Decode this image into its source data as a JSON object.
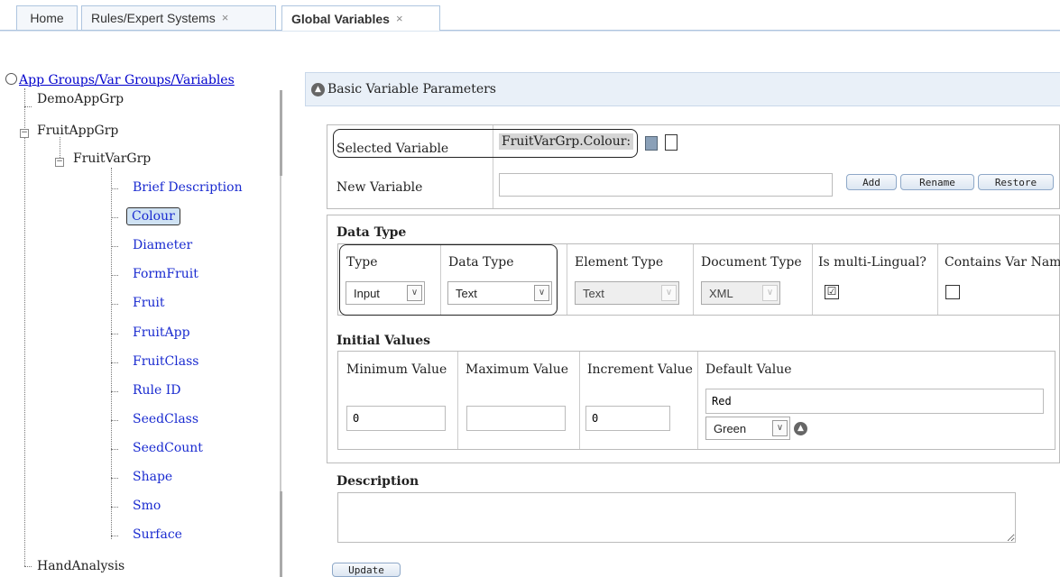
{
  "tabs": [
    {
      "label": "Home",
      "closable": false
    },
    {
      "label": "Rules/Expert Systems",
      "closable": true
    },
    {
      "label": "Global Variables",
      "closable": true,
      "active": true
    }
  ],
  "close_glyph": "×",
  "tree": {
    "root_label": "App Groups/Var Groups/Variables",
    "nodes": {
      "demo": "DemoAppGrp",
      "fruitapp": "FruitAppGrp",
      "fruitvar": "FruitVarGrp",
      "vars": [
        "Brief Description",
        "Colour",
        "Diameter",
        "FormFruit",
        "Fruit",
        "FruitApp",
        "FruitClass",
        "Rule ID",
        "SeedClass",
        "SeedCount",
        "Shape",
        "Smo",
        "Surface"
      ],
      "hand": "HandAnalysis"
    },
    "selected": "Colour"
  },
  "panel": {
    "title": "Basic Variable Parameters",
    "selected_variable_label": "Selected Variable",
    "selected_variable_value": "FruitVarGrp.Colour:",
    "new_variable_label": "New Variable",
    "new_variable_value": "",
    "buttons": {
      "add": "Add",
      "rename": "Rename",
      "restore": "Restore",
      "update": "Update"
    },
    "data_type_section": "Data Type",
    "columns": {
      "type": "Type",
      "data_type": "Data Type",
      "element_type": "Element Type",
      "document_type": "Document Type",
      "multi_lingual": "Is multi-Lingual?",
      "contains_var": "Contains Var Nam"
    },
    "values": {
      "type": "Input",
      "data_type": "Text",
      "element_type": "Text",
      "document_type": "XML",
      "multi_lingual_checked": "☑",
      "contains_var_checked": ""
    },
    "initial_values_section": "Initial Values",
    "initial_columns": {
      "min": "Minimum Value",
      "max": "Maximum Value",
      "inc": "Increment Value",
      "def": "Default Value"
    },
    "initial_values": {
      "min": "0",
      "max": "",
      "inc": "0",
      "default_text": "Red",
      "default_select": "Green"
    },
    "description_section": "Description",
    "description_value": ""
  },
  "colors": {
    "tab_border": "#aec5df",
    "link": "#1a2bd0",
    "header_bg": "#e9f0f8"
  }
}
